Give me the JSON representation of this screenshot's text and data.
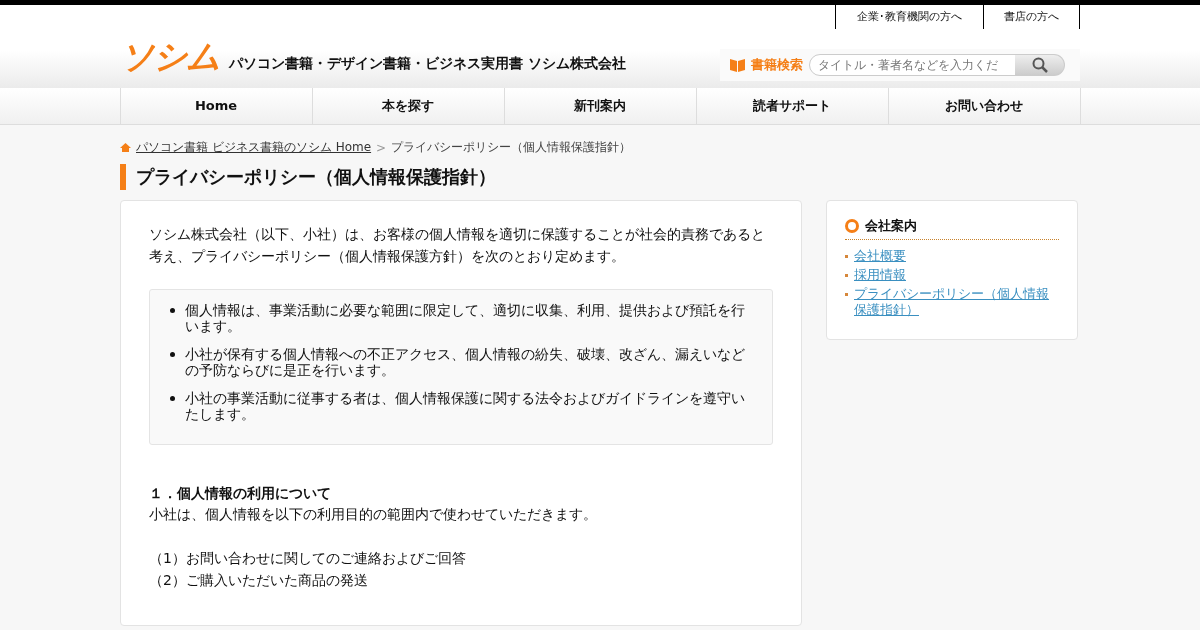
{
  "top_links": [
    "企業･教育機関の方へ",
    "書店の方へ"
  ],
  "logo": "ソシム",
  "tagline": "パソコン書籍・デザイン書籍・ビジネス実用書 ソシム株式会社",
  "search": {
    "label": "書籍検索",
    "placeholder": "タイトル・著者名などを入力くだ"
  },
  "nav": [
    {
      "label": "Home",
      "selected": false
    },
    {
      "label": "本を探す",
      "selected": false
    },
    {
      "label": "新刊案内",
      "selected": false
    },
    {
      "label": "読者サポート",
      "selected": false
    },
    {
      "label": "お問い合わせ",
      "selected": false
    }
  ],
  "breadcrumb": {
    "link": "パソコン書籍 ビジネス書籍のソシム Home",
    "separator": ">",
    "current": "プライバシーポリシー（個人情報保護指針）"
  },
  "page_title": "プライバシーポリシー（個人情報保護指針）",
  "intro": "ソシム株式会社（以下、小社）は、お客様の個人情報を適切に保護することが社会的責務であると考え、プライバシーポリシー（個人情報保護方針）を次のとおり定めます。",
  "principles": [
    "個人情報は、事業活動に必要な範囲に限定して、適切に収集、利用、提供および預託を行います。",
    "小社が保有する個人情報への不正アクセス、個人情報の紛失、破壊、改ざん、漏えいなどの予防ならびに是正を行います。",
    "小社の事業活動に従事する者は、個人情報保護に関する法令およびガイドラインを遵守いたします。"
  ],
  "section": {
    "heading": "１．個人情報の利用について",
    "text": "小社は、個人情報を以下の利用目的の範囲内で使わせていただきます。",
    "items": [
      "（1）お問い合わせに関してのご連絡およびご回答",
      "（2）ご購入いただいた商品の発送"
    ]
  },
  "sidebar": {
    "title": "会社案内",
    "links": [
      "会社概要",
      "採用情報",
      "プライバシーポリシー（個人情報保護指針）"
    ]
  }
}
